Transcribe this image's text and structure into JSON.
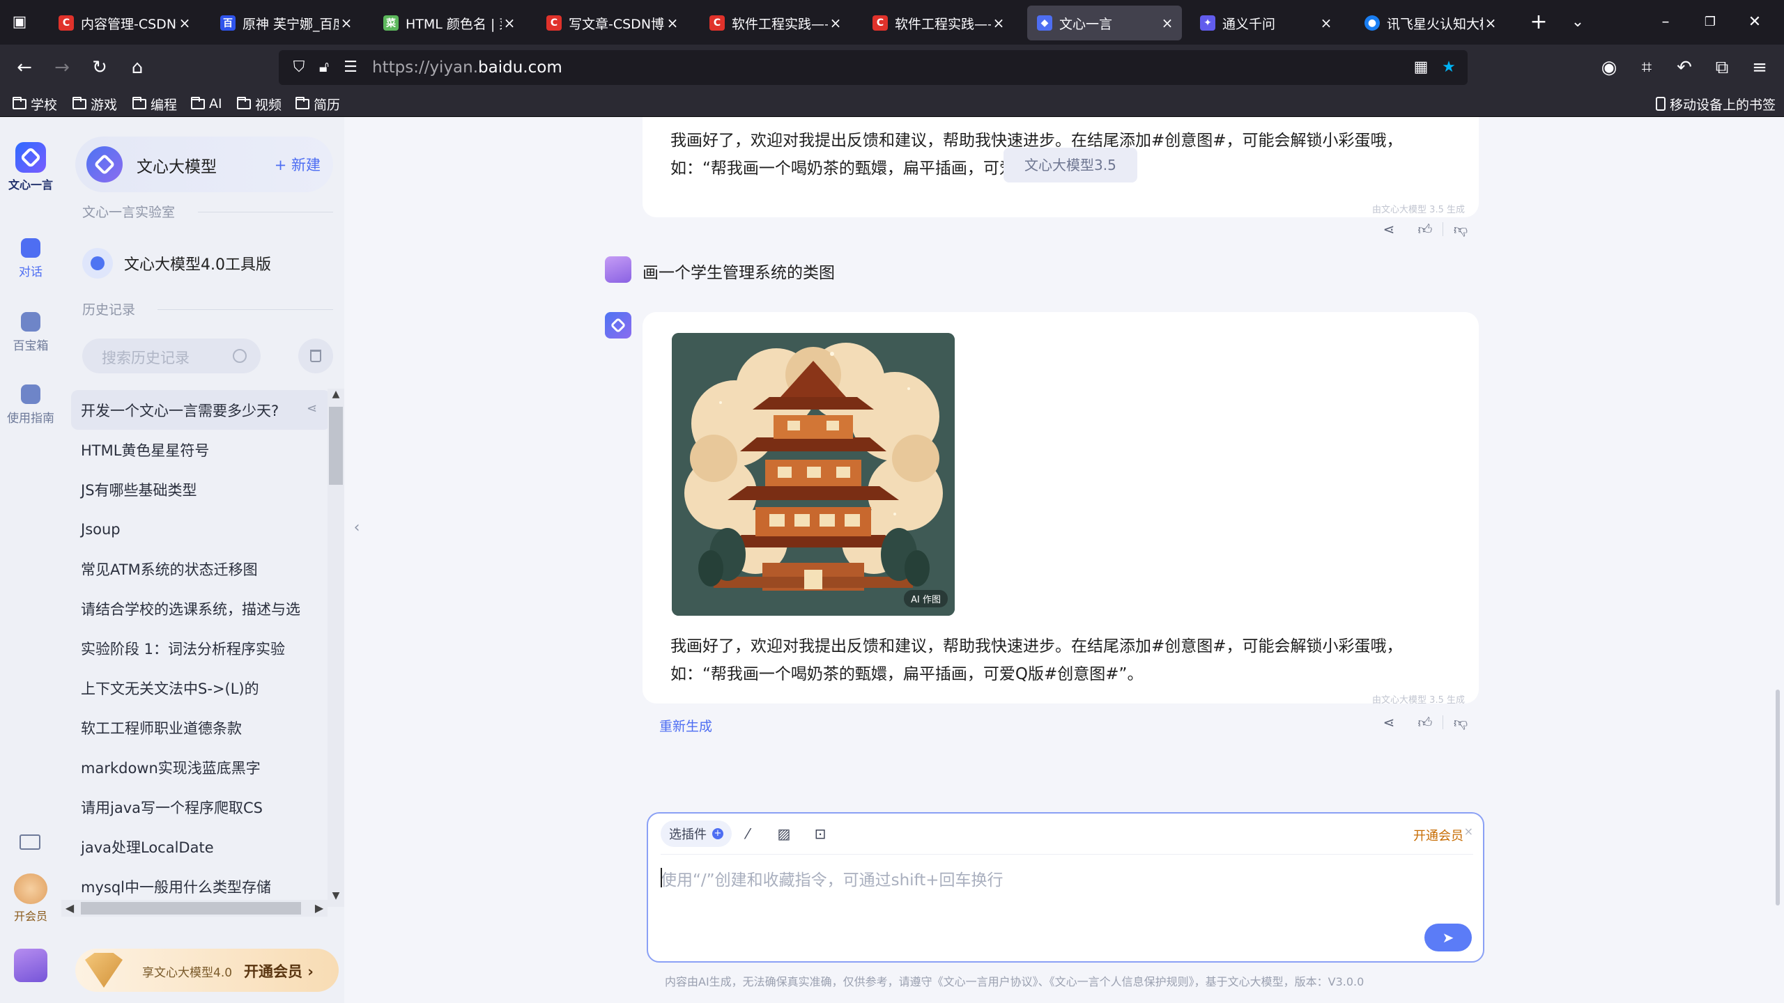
{
  "browser": {
    "tabs": [
      {
        "title": "内容管理-CSDN创",
        "favicon_color": "#e0322b",
        "favicon_char": "C"
      },
      {
        "title": "原神 芙宁娜_百度",
        "favicon_color": "#2f54eb",
        "favicon_char": "百"
      },
      {
        "title": "HTML 颜色名 | 菜",
        "favicon_color": "#5cb85c",
        "favicon_char": "菜"
      },
      {
        "title": "写文章-CSDN博客",
        "favicon_color": "#e0322b",
        "favicon_char": "C"
      },
      {
        "title": "软件工程实践——",
        "favicon_color": "#e0322b",
        "favicon_char": "C"
      },
      {
        "title": "软件工程实践——",
        "favicon_color": "#e0322b",
        "favicon_char": "C"
      },
      {
        "title": "文心一言",
        "favicon_color": "#4e6ef2",
        "favicon_char": "◆"
      },
      {
        "title": "通义千问",
        "favicon_color": "#615ced",
        "favicon_char": "✦"
      },
      {
        "title": "讯飞星火认知大模",
        "favicon_color": "#1a7ef2",
        "favicon_char": "●"
      }
    ],
    "url_prefix": "https://yiyan.",
    "url_domain": "baidu.com",
    "bookmarks": [
      "学校",
      "游戏",
      "编程",
      "AI",
      "视频",
      "简历"
    ],
    "mobile_bookmarks": "移动设备上的书签"
  },
  "rail": {
    "logo_text": "文心一言",
    "items": [
      {
        "label": "对话"
      },
      {
        "label": "百宝箱"
      },
      {
        "label": "使用指南"
      }
    ],
    "vip_label": "开会员"
  },
  "sidebar": {
    "model_name": "文心大模型",
    "new_label": "+ 新建",
    "lab_section": "文心一言实验室",
    "tool_item": "文心大模型4.0工具版",
    "history_section": "历史记录",
    "search_placeholder": "搜索历史记录",
    "history": [
      "开发一个文心一言需要多少天?",
      "HTML黄色星星符号",
      "JS有哪些基础类型",
      "Jsoup",
      "常见ATM系统的状态迁移图",
      "请结合学校的选课系统，描述与选",
      "实验阶段 1：词法分析程序实验",
      "上下文无关文法中S->(L)的",
      "软工工程师职业道德条款",
      "markdown实现浅蓝底黑字",
      "请用java写一个程序爬取CS",
      "java处理LocalDate",
      "mysql中一般用什么类型存储"
    ],
    "vip_banner_text": "享文心大模型4.0",
    "vip_banner_cta": "开通会员 ›"
  },
  "chat": {
    "reply1": "我画好了，欢迎对我提出反馈和建议，帮助我快速进步。在结尾添加#创意图#，可能会解锁小彩蛋哦，如：“帮我画一个喝奶茶的甄嬛，扁平插画，可爱Q版#创意图#”。",
    "tooltip": "文心大模型3.5",
    "generated_by": "由文心大模型 3.5 生成",
    "user_message": "画一个学生管理系统的类图",
    "image_badge": "AI 作图",
    "reply2": "我画好了，欢迎对我提出反馈和建议，帮助我快速进步。在结尾添加#创意图#，可能会解锁小彩蛋哦，如：“帮我画一个喝奶茶的甄嬛，扁平插画，可爱Q版#创意图#”。",
    "regenerate": "重新生成"
  },
  "composer": {
    "plugin_label": "选插件",
    "member_link": "开通会员",
    "placeholder": "使用“/”创建和收藏指令，可通过shift+回车换行",
    "footer": "内容由AI生成，无法确保真实准确，仅供参考，请遵守《文心一言用户协议》、《文心一言个人信息保护规则》，基于文心大模型，版本：V3.0.0"
  },
  "colors": {
    "accent": "#4e6ef2",
    "member_orange": "#c76b00"
  }
}
